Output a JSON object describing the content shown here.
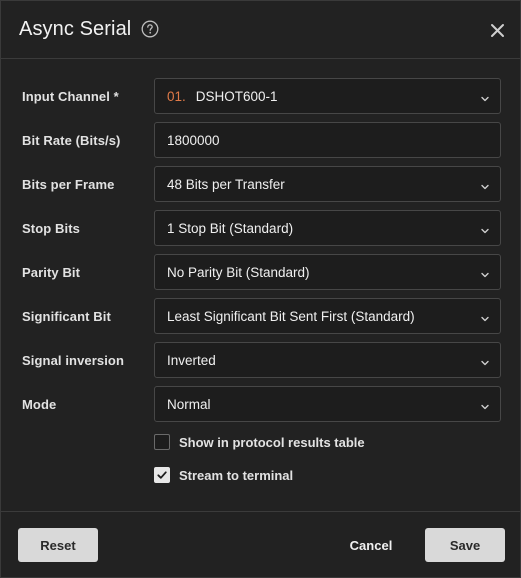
{
  "dialog": {
    "title": "Async Serial"
  },
  "fields": {
    "input_channel": {
      "label": "Input Channel *",
      "prefix": "01.",
      "value": "DSHOT600-1"
    },
    "bit_rate": {
      "label": "Bit Rate (Bits/s)",
      "value": "1800000"
    },
    "bits_per_frame": {
      "label": "Bits per Frame",
      "value": "48 Bits per Transfer"
    },
    "stop_bits": {
      "label": "Stop Bits",
      "value": "1 Stop Bit (Standard)"
    },
    "parity_bit": {
      "label": "Parity Bit",
      "value": "No Parity Bit (Standard)"
    },
    "significant_bit": {
      "label": "Significant Bit",
      "value": "Least Significant Bit Sent First (Standard)"
    },
    "signal_inversion": {
      "label": "Signal inversion",
      "value": "Inverted"
    },
    "mode": {
      "label": "Mode",
      "value": "Normal"
    }
  },
  "options": {
    "show_in_table": {
      "label": "Show in protocol results table",
      "checked": false
    },
    "stream_to_terminal": {
      "label": "Stream to terminal",
      "checked": true
    }
  },
  "footer": {
    "reset_label": "Reset",
    "cancel_label": "Cancel",
    "save_label": "Save"
  },
  "colors": {
    "background": "#222222",
    "field_background": "#1d1d1d",
    "channel_prefix": "#e07a48",
    "button": "#d9d9d9"
  },
  "icons": [
    "help-circle-icon",
    "close-icon",
    "chevron-down-icon",
    "checkmark-icon"
  ]
}
